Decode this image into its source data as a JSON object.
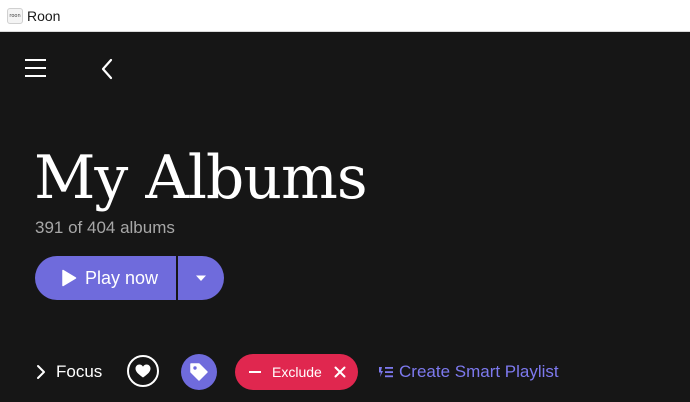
{
  "window": {
    "title": "Roon",
    "icon_text": "roon"
  },
  "nav": {
    "menu_icon": "hamburger-menu-icon",
    "back_icon": "chevron-left-icon"
  },
  "header": {
    "title": "My Albums",
    "count": "391 of 404 albums"
  },
  "play": {
    "label": "Play now",
    "icon": "play-icon",
    "dropdown_icon": "caret-down-icon"
  },
  "filters": {
    "focus_label": "Focus",
    "focus_icon": "chevron-right-icon",
    "favorite_icon": "heart-icon",
    "tag_icon": "tag-icon",
    "exclude_label": "Exclude",
    "exclude_icon": "minus-icon",
    "exclude_close_icon": "close-icon",
    "smart_playlist_label": "Create Smart Playlist",
    "smart_playlist_icon": "smart-playlist-icon"
  },
  "colors": {
    "background": "#161616",
    "accent": "#6f6bdc",
    "exclude": "#e0274f",
    "link": "#7d79ee"
  }
}
